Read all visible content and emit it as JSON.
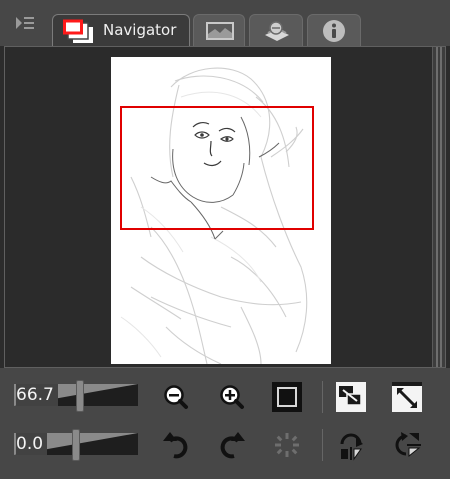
{
  "tabs": [
    {
      "label": "Navigator",
      "icon": "navigator-icon",
      "active": true
    },
    {
      "label": "",
      "icon": "image-preview-icon"
    },
    {
      "label": "",
      "icon": "layer-search-icon"
    },
    {
      "label": "",
      "icon": "info-icon"
    }
  ],
  "zoom": {
    "value": "66.7"
  },
  "rotation": {
    "value": "0.0"
  },
  "colors": {
    "viewport_frame": "#e00000",
    "panel_bg": "#474747",
    "canvas_bg": "#ffffff"
  }
}
